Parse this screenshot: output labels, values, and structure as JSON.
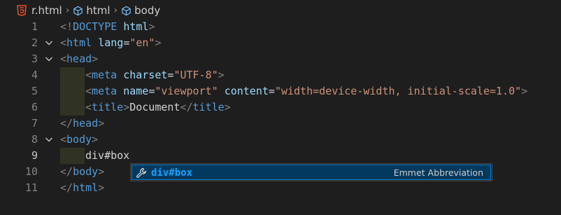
{
  "breadcrumb": {
    "file": "r.html",
    "segments": [
      "html",
      "body"
    ]
  },
  "lines": [
    {
      "n": "1",
      "fold": false,
      "indent": 0,
      "tokens": [
        [
          "punc",
          "<!"
        ],
        [
          "tag",
          "DOCTYPE"
        ],
        [
          "text",
          " "
        ],
        [
          "attr",
          "html"
        ],
        [
          "punc",
          ">"
        ]
      ]
    },
    {
      "n": "2",
      "fold": true,
      "indent": 0,
      "tokens": [
        [
          "punc",
          "<"
        ],
        [
          "tag",
          "html"
        ],
        [
          "text",
          " "
        ],
        [
          "attr",
          "lang"
        ],
        [
          "text",
          "="
        ],
        [
          "str",
          "\"en\""
        ],
        [
          "punc",
          ">"
        ]
      ]
    },
    {
      "n": "3",
      "fold": true,
      "indent": 0,
      "tokens": [
        [
          "punc",
          "<"
        ],
        [
          "tag",
          "head"
        ],
        [
          "punc",
          ">"
        ]
      ]
    },
    {
      "n": "4",
      "fold": false,
      "indent": 1,
      "tokens": [
        [
          "punc",
          "<"
        ],
        [
          "tag",
          "meta"
        ],
        [
          "text",
          " "
        ],
        [
          "attr",
          "charset"
        ],
        [
          "text",
          "="
        ],
        [
          "str",
          "\"UTF-8\""
        ],
        [
          "punc",
          ">"
        ]
      ]
    },
    {
      "n": "5",
      "fold": false,
      "indent": 1,
      "tokens": [
        [
          "punc",
          "<"
        ],
        [
          "tag",
          "meta"
        ],
        [
          "text",
          " "
        ],
        [
          "attr",
          "name"
        ],
        [
          "text",
          "="
        ],
        [
          "str",
          "\"viewport\""
        ],
        [
          "text",
          " "
        ],
        [
          "attr",
          "content"
        ],
        [
          "text",
          "="
        ],
        [
          "str",
          "\"width=device-width, initial-scale=1.0\""
        ],
        [
          "punc",
          ">"
        ]
      ]
    },
    {
      "n": "6",
      "fold": false,
      "indent": 1,
      "tokens": [
        [
          "punc",
          "<"
        ],
        [
          "tag",
          "title"
        ],
        [
          "punc",
          ">"
        ],
        [
          "text",
          "Document"
        ],
        [
          "punc",
          "</"
        ],
        [
          "tag",
          "title"
        ],
        [
          "punc",
          ">"
        ]
      ]
    },
    {
      "n": "7",
      "fold": false,
      "indent": 0,
      "tokens": [
        [
          "punc",
          "</"
        ],
        [
          "tag",
          "head"
        ],
        [
          "punc",
          ">"
        ]
      ]
    },
    {
      "n": "8",
      "fold": true,
      "indent": 0,
      "tokens": [
        [
          "punc",
          "<"
        ],
        [
          "tag",
          "body"
        ],
        [
          "punc",
          ">"
        ]
      ]
    },
    {
      "n": "9",
      "fold": false,
      "indent": 1,
      "active": true,
      "tokens": [
        [
          "text",
          "div#box"
        ]
      ]
    },
    {
      "n": "10",
      "fold": false,
      "indent": 0,
      "tokens": [
        [
          "punc",
          "</"
        ],
        [
          "tag",
          "body"
        ],
        [
          "punc",
          ">"
        ]
      ]
    },
    {
      "n": "11",
      "fold": false,
      "indent": 0,
      "tokens": [
        [
          "punc",
          "</"
        ],
        [
          "tag",
          "html"
        ],
        [
          "punc",
          ">"
        ]
      ]
    }
  ],
  "suggestion": {
    "label": "div#box",
    "detail": "Emmet Abbreviation"
  },
  "colors": {
    "tag": "#569cd6",
    "attr": "#9cdcfe",
    "string": "#ce9178",
    "punctuation": "#808080",
    "highlight": "#18a3ff"
  }
}
